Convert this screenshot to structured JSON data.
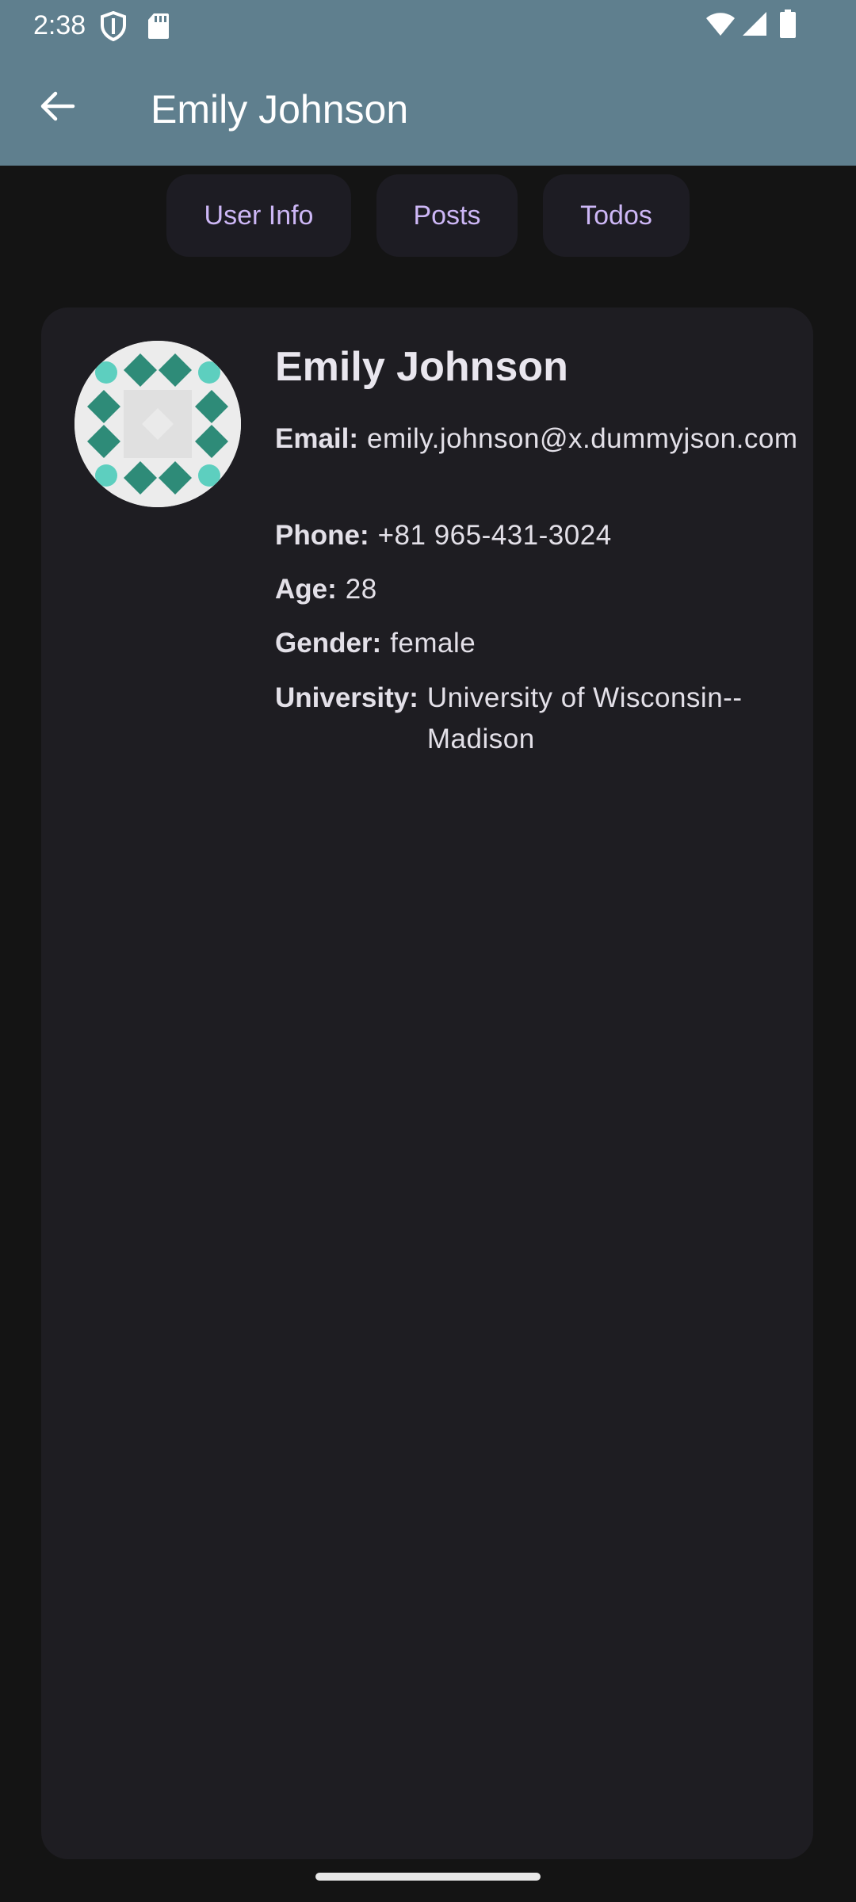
{
  "status_bar": {
    "time": "2:38",
    "icons": [
      "shield-icon",
      "sd-card-icon",
      "wifi-icon",
      "signal-icon",
      "battery-icon"
    ]
  },
  "toolbar": {
    "title": "Emily Johnson",
    "back_icon": "arrow-back-icon"
  },
  "tabs": [
    {
      "label": "User Info"
    },
    {
      "label": "Posts"
    },
    {
      "label": "Todos"
    }
  ],
  "profile": {
    "name": "Emily Johnson",
    "avatar_icon": "identicon-avatar",
    "fields": [
      {
        "label": "Email:",
        "value": "emily.johnson@x.dummyjson.com"
      },
      {
        "label": "Phone:",
        "value": "+81 965-431-3024"
      },
      {
        "label": "Age:",
        "value": "28"
      },
      {
        "label": "Gender:",
        "value": "female"
      },
      {
        "label": "University:",
        "value": "University of Wisconsin--Madison"
      }
    ]
  },
  "colors": {
    "app_bar": "#5f7f8e",
    "background": "#141414",
    "card": "#1e1d22",
    "tab_text": "#cdb7f6",
    "avatar_teal": "#2e8b78",
    "avatar_mint": "#5dcfbf"
  }
}
